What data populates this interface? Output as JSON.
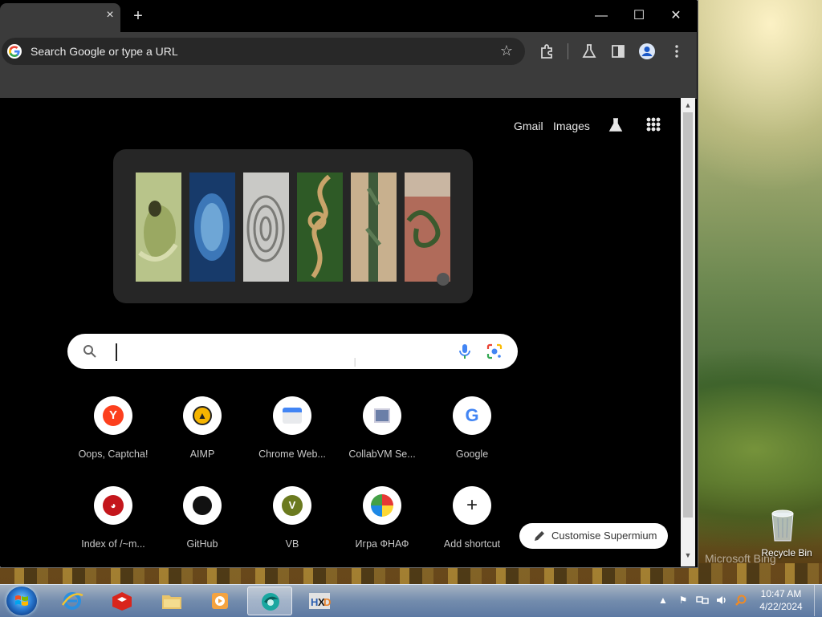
{
  "browser": {
    "tab": {
      "close": "×",
      "new_tab": "+"
    },
    "window_controls": {
      "minimize": "—",
      "maximize": "☐",
      "close": "✕"
    },
    "omnibox": {
      "placeholder": "Search Google or type a URL"
    },
    "toolbar_icons": [
      "bookmark-star-icon",
      "extensions-icon",
      "labs-icon",
      "side-panel-icon",
      "profile-icon",
      "menu-icon"
    ]
  },
  "ntp": {
    "top_links": {
      "gmail": "Gmail",
      "images": "Images"
    },
    "search": {
      "value": ""
    },
    "shortcuts": [
      {
        "label": "Oops, Captcha!",
        "icon": "yandex-icon"
      },
      {
        "label": "AIMP",
        "icon": "aimp-icon"
      },
      {
        "label": "Chrome Web...",
        "icon": "chrome-web-store-icon"
      },
      {
        "label": "CollabVM Se...",
        "icon": "collabvm-icon"
      },
      {
        "label": "Google",
        "icon": "google-icon"
      },
      {
        "label": "Index of /~m...",
        "icon": "freebsd-icon"
      },
      {
        "label": "GitHub",
        "icon": "github-icon"
      },
      {
        "label": "VB",
        "icon": "vb-icon"
      },
      {
        "label": "Игра ФНАФ",
        "icon": "fnaf-icon"
      },
      {
        "label": "Add shortcut",
        "icon": "plus-icon"
      }
    ],
    "customise_label": "Customise Supermium"
  },
  "desktop": {
    "recycle_bin_label": "Recycle Bin",
    "wallpaper_watermark": "Microsoft Bing"
  },
  "taskbar": {
    "clock_time": "10:47 AM",
    "clock_date": "4/22/2024",
    "tray_overflow": "▲"
  },
  "colors": {
    "browser_chrome": "#3b3b3b",
    "ntp_background": "#000000",
    "doodle_card": "#262626"
  }
}
